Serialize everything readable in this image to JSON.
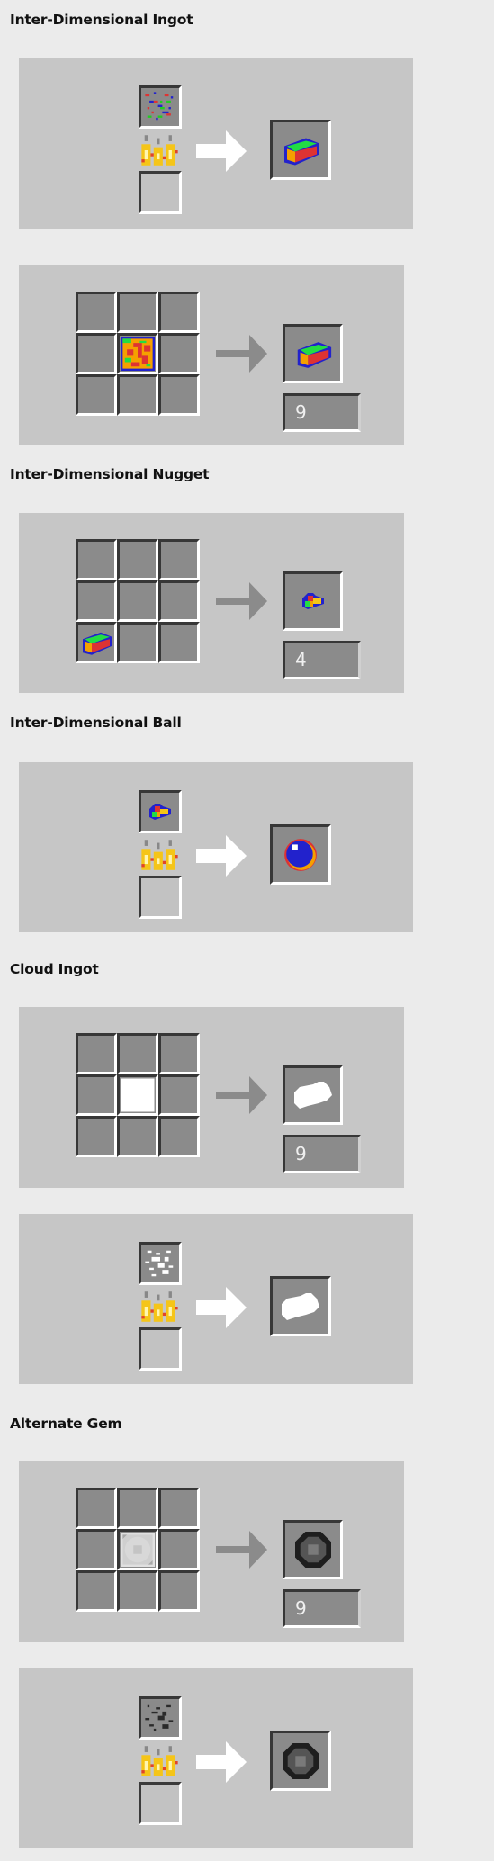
{
  "sections": [
    {
      "title": "Inter-Dimensional Ingot",
      "recipes": [
        {
          "type": "smelting",
          "input": "inter-dimensional-ore",
          "fuel": "empty",
          "output": "inter-dimensional-ingot"
        },
        {
          "type": "crafting",
          "grid": [
            "",
            "",
            "",
            "",
            "inter-dimensional-block",
            "",
            "",
            "",
            ""
          ],
          "output": "inter-dimensional-ingot",
          "count": "9"
        }
      ]
    },
    {
      "title": "Inter-Dimensional Nugget",
      "recipes": [
        {
          "type": "crafting",
          "grid": [
            "",
            "",
            "",
            "",
            "",
            "",
            "inter-dimensional-ingot",
            "",
            ""
          ],
          "output": "inter-dimensional-nugget",
          "count": "4"
        }
      ]
    },
    {
      "title": "Inter-Dimensional Ball",
      "recipes": [
        {
          "type": "smelting",
          "input": "inter-dimensional-nugget",
          "fuel": "empty",
          "output": "inter-dimensional-ball"
        }
      ]
    },
    {
      "title": "Cloud Ingot",
      "recipes": [
        {
          "type": "crafting",
          "grid": [
            "",
            "",
            "",
            "",
            "cloud-block",
            "",
            "",
            "",
            ""
          ],
          "output": "cloud-ingot",
          "count": "9"
        },
        {
          "type": "smelting",
          "input": "cloud-ore",
          "fuel": "empty",
          "output": "cloud-ingot"
        }
      ]
    },
    {
      "title": "Alternate Gem",
      "recipes": [
        {
          "type": "crafting",
          "grid": [
            "",
            "",
            "",
            "",
            "alternate-gem-block",
            "",
            "",
            "",
            ""
          ],
          "output": "alternate-gem",
          "count": "9"
        },
        {
          "type": "smelting",
          "input": "alternate-gem-ore",
          "fuel": "empty",
          "output": "alternate-gem"
        }
      ]
    }
  ],
  "colors": {
    "page_background": "#ebebeb",
    "panel_background": "#c6c6c6",
    "slot_background": "#8b8b8b",
    "smelting_arrow": "#ffffff",
    "crafting_arrow": "#8b8b8b"
  }
}
